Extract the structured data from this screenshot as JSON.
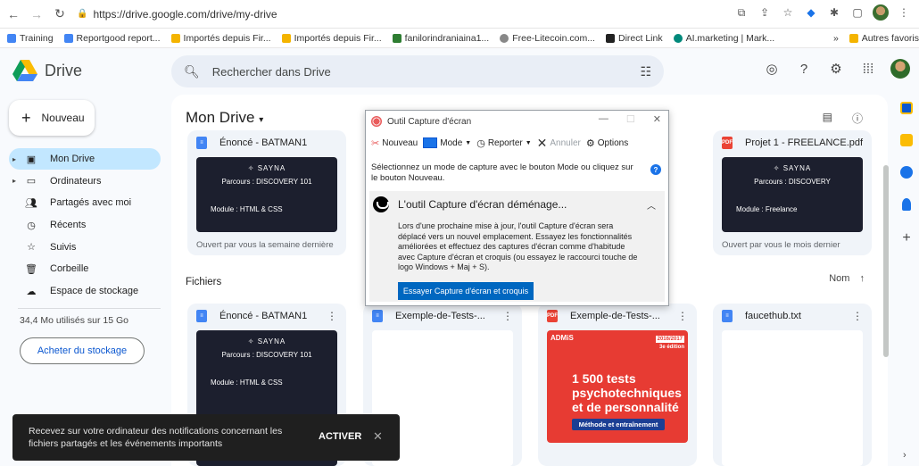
{
  "browser": {
    "url": "https://drive.google.com/drive/my-drive",
    "bookmarks": [
      "Training",
      "Reportgood report...",
      "Importés depuis Fir...",
      "Importés depuis Fir...",
      "fanilorindraniaina1...",
      "Free-Litecoin.com...",
      "Direct Link",
      "AI.marketing | Mark..."
    ],
    "bookmarks_more": "»",
    "bookmarks_other": "Autres favoris"
  },
  "header": {
    "app_name": "Drive",
    "search_placeholder": "Rechercher dans Drive"
  },
  "sidebar": {
    "new_label": "Nouveau",
    "items": [
      {
        "label": "Mon Drive",
        "icon": "drive-icon"
      },
      {
        "label": "Ordinateurs",
        "icon": "computer-icon"
      },
      {
        "label": "Partagés avec moi",
        "icon": "shared-icon"
      },
      {
        "label": "Récents",
        "icon": "clock-icon"
      },
      {
        "label": "Suivis",
        "icon": "star-icon"
      },
      {
        "label": "Corbeille",
        "icon": "trash-icon"
      },
      {
        "label": "Espace de stockage",
        "icon": "cloud-icon"
      }
    ],
    "storage_text": "34,4 Mo utilisés sur 15 Go",
    "buy_label": "Acheter du stockage"
  },
  "main": {
    "title": "Mon Drive",
    "section_files": "Fichiers",
    "sort_label": "Nom",
    "suggested": [
      {
        "name": "Énoncé - BATMAN1",
        "type": "doc",
        "brand": "SAYNA",
        "parcours": "Parcours : DISCOVERY 101",
        "module": "Module : HTML & CSS",
        "footer": "Ouvert par vous la semaine dernière"
      },
      {
        "name": "Projet 1 - FREELANCE.pdf",
        "type": "pdf",
        "brand": "SAYNA",
        "parcours": "Parcours : DISCOVERY",
        "module": "Module : Freelance",
        "footer": "Ouvert par vous le mois dernier"
      }
    ],
    "files": [
      {
        "name": "Énoncé - BATMAN1",
        "type": "doc",
        "brand": "SAYNA",
        "parcours": "Parcours : DISCOVERY 101",
        "module": "Module : HTML & CSS"
      },
      {
        "name": "Exemple-de-Tests-...",
        "type": "doc"
      },
      {
        "name": "Exemple-de-Tests-...",
        "type": "pdf",
        "cover": {
          "brand": "ADMiS",
          "edition": "2016/2017",
          "edition_note": "3e édition",
          "headline": "1 500 tests psychotechniques et de personnalité",
          "footer": "Méthode et entraînement"
        }
      },
      {
        "name": "faucethub.txt",
        "type": "txt"
      }
    ]
  },
  "snipping_tool": {
    "title": "Outil Capture d'écran",
    "toolbar": {
      "new": "Nouveau",
      "mode": "Mode",
      "delay": "Reporter",
      "cancel": "Annuler",
      "options": "Options"
    },
    "message": "Sélectionnez un mode de capture avec le bouton Mode ou cliquez sur le bouton Nouveau.",
    "panel_title": "L'outil Capture d'écran déménage...",
    "panel_body": "Lors d'une prochaine mise à jour, l'outil Capture d'écran sera déplacé vers un nouvel emplacement. Essayez les fonctionnalités améliorées et effectuez des captures d'écran comme d'habitude avec Capture d'écran et croquis (ou essayez le raccourci touche de logo Windows + Maj + S).",
    "panel_button": "Essayer Capture d'écran et croquis"
  },
  "toast": {
    "text": "Recevez sur votre ordinateur des notifications concernant les fichiers partagés et les événements importants",
    "action": "ACTIVER"
  },
  "colors": {
    "accent": "#0b57d0",
    "active_nav": "#c2e7ff",
    "pdf": "#ea4335",
    "doc": "#4285f4"
  }
}
